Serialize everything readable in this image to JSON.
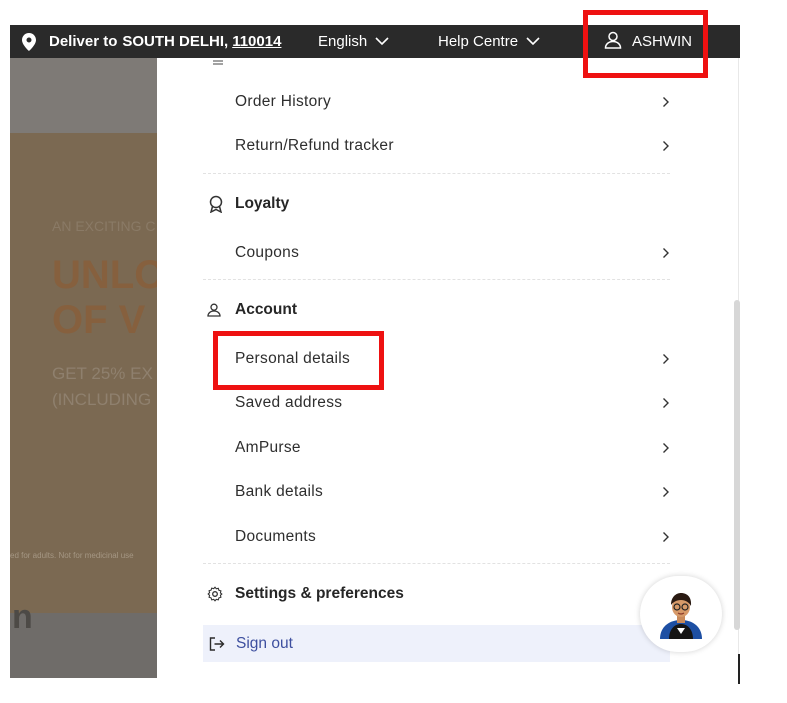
{
  "topbar": {
    "deliver_prefix": "Deliver to",
    "city": "SOUTH DELHI,",
    "pincode": "110014",
    "language": "English",
    "help": "Help Centre",
    "user": "ASHWIN",
    "icons": [
      "location-pin-icon",
      "chevron-down-icon",
      "user-icon"
    ]
  },
  "backdrop": {
    "promo_small": "AN EXCITING C",
    "promo_big_line1": "UNLO",
    "promo_big_line2": "OF V",
    "promo_offer_line1": "GET 25% EX",
    "promo_offer_line2": "(INCLUDING",
    "fine_print": "ed for adults. Not for medicinal use",
    "cut_text": "n"
  },
  "menu": {
    "orders_items": [
      {
        "label": "Order History"
      },
      {
        "label": "Return/Refund tracker"
      }
    ],
    "loyalty": {
      "title": "Loyalty",
      "items": [
        {
          "label": "Coupons"
        }
      ]
    },
    "account": {
      "title": "Account",
      "items": [
        {
          "label": "Personal details"
        },
        {
          "label": "Saved address"
        },
        {
          "label": "AmPurse"
        },
        {
          "label": "Bank details"
        },
        {
          "label": "Documents"
        }
      ]
    },
    "settings": {
      "title": "Settings & preferences"
    },
    "signout": {
      "label": "Sign out"
    }
  },
  "colors": {
    "topbar_bg": "#2a2a2a",
    "highlight": "#ee1111",
    "signout_bg": "#eef1fb",
    "signout_text": "#3d4f9f"
  }
}
